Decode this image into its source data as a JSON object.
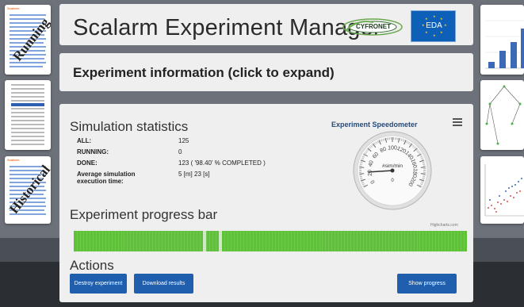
{
  "sidebar_left": {
    "running_label": "Running",
    "historical_label": "Historical",
    "thumb_header": "Scalarm"
  },
  "header": {
    "title": "Scalarm Experiment Manager",
    "logo_cyfronet": "CYFRONET",
    "logo_eda": "EDA"
  },
  "experiment_info": {
    "label": "Experiment information (click to expand)"
  },
  "simulation_statistics": {
    "title": "Simulation statistics",
    "rows": [
      {
        "key": "ALL:",
        "value": "125"
      },
      {
        "key": "RUNNING:",
        "value": "0"
      },
      {
        "key": "DONE:",
        "value": "123 ( '98.40' % COMPLETED )"
      },
      {
        "key": "Average simulation execution time:",
        "value": "5 [m] 23 [s]"
      }
    ]
  },
  "speedometer": {
    "title": "Experiment Speedometer",
    "unit": "#sim/min",
    "ticks": [
      "0",
      "20",
      "40",
      "60",
      "80",
      "100",
      "120",
      "140",
      "160",
      "180",
      "200"
    ],
    "value": 0,
    "needle_value": 22,
    "max": 200,
    "credit": "Highcharts.com"
  },
  "progress_bar": {
    "title": "Experiment progress bar",
    "completed_fraction": 0.984,
    "color": "#5ec139"
  },
  "actions": {
    "title": "Actions",
    "destroy_label": "Destroy experiment",
    "download_label": "Download results",
    "show_progress_label": "Show progress"
  },
  "colors": {
    "accent_blue": "#1f5fad",
    "progress_green": "#5ec139",
    "speedo_title": "#274b7a"
  }
}
